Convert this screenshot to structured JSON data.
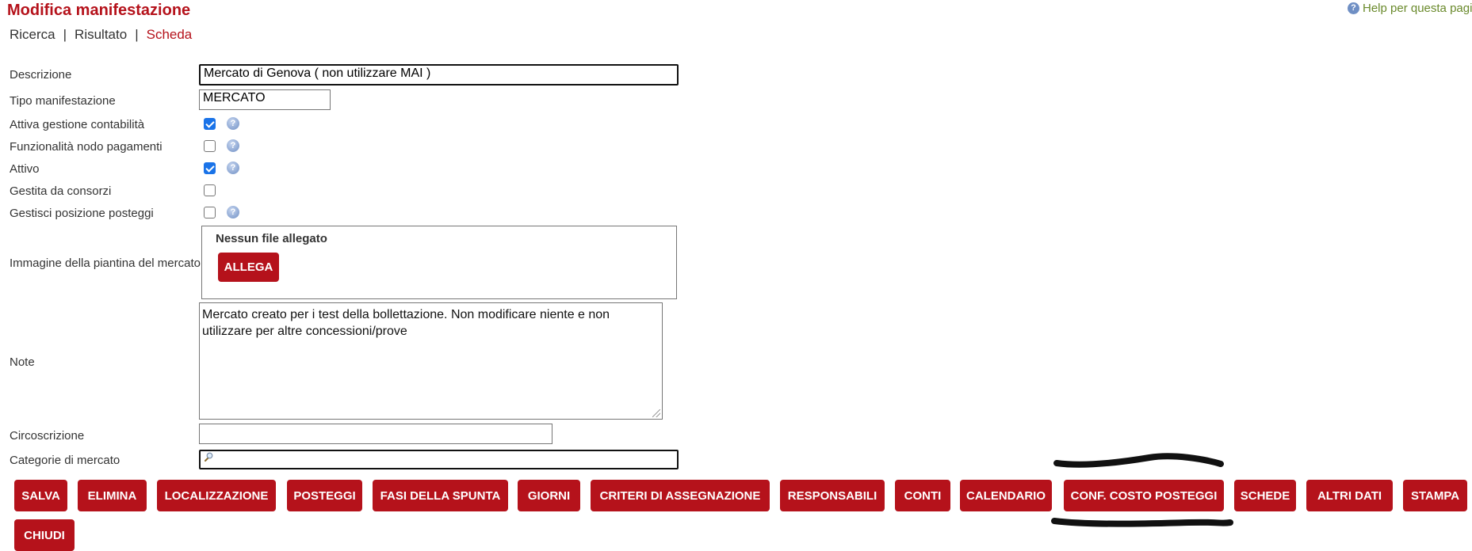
{
  "page": {
    "title": "Modifica manifestazione",
    "help_label": "Help per questa pagina",
    "help_icon": "help-icon"
  },
  "breadcrumb": {
    "items": [
      "Ricerca",
      "Risultato",
      "Scheda"
    ],
    "active": "Scheda",
    "separator": "|"
  },
  "form": {
    "descrizione": {
      "label": "Descrizione",
      "value": "Mercato di Genova ( non utilizzare MAI )"
    },
    "tipo": {
      "label": "Tipo manifestazione",
      "value": "MERCATO"
    },
    "checks": [
      {
        "label": "Attiva gestione contabilità",
        "checked": true,
        "help": true
      },
      {
        "label": "Funzionalità nodo pagamenti",
        "checked": false,
        "help": true
      },
      {
        "label": "Attivo",
        "checked": true,
        "help": true
      },
      {
        "label": "Gestita da consorzi",
        "checked": false,
        "help": false
      },
      {
        "label": "Gestisci posizione posteggi",
        "checked": false,
        "help": true
      }
    ],
    "immagine": {
      "label": "Immagine della piantina del mercato",
      "no_file": "Nessun file allegato",
      "attach_label": "ALLEGA"
    },
    "note": {
      "label": "Note",
      "value": "Mercato creato per i test della bollettazione. Non modificare niente e non utilizzare per altre concessioni/prove"
    },
    "circoscrizione": {
      "label": "Circoscrizione",
      "value": ""
    },
    "categorie": {
      "label": "Categorie di mercato",
      "value": ""
    }
  },
  "actions": [
    "SALVA",
    "ELIMINA",
    "LOCALIZZAZIONE",
    "POSTEGGI",
    "FASI DELLA SPUNTA",
    "GIORNI",
    "CRITERI DI ASSEGNAZIONE",
    "RESPONSABILI",
    "CONTI",
    "CALENDARIO",
    "CONF. COSTO POSTEGGI",
    "SCHEDE",
    "ALTRI DATI",
    "STAMPA",
    "CHIUDI"
  ],
  "colors": {
    "brand_red": "#b5121b",
    "help_green": "#6a8a2c",
    "checkbox_blue": "#1a73e8"
  }
}
